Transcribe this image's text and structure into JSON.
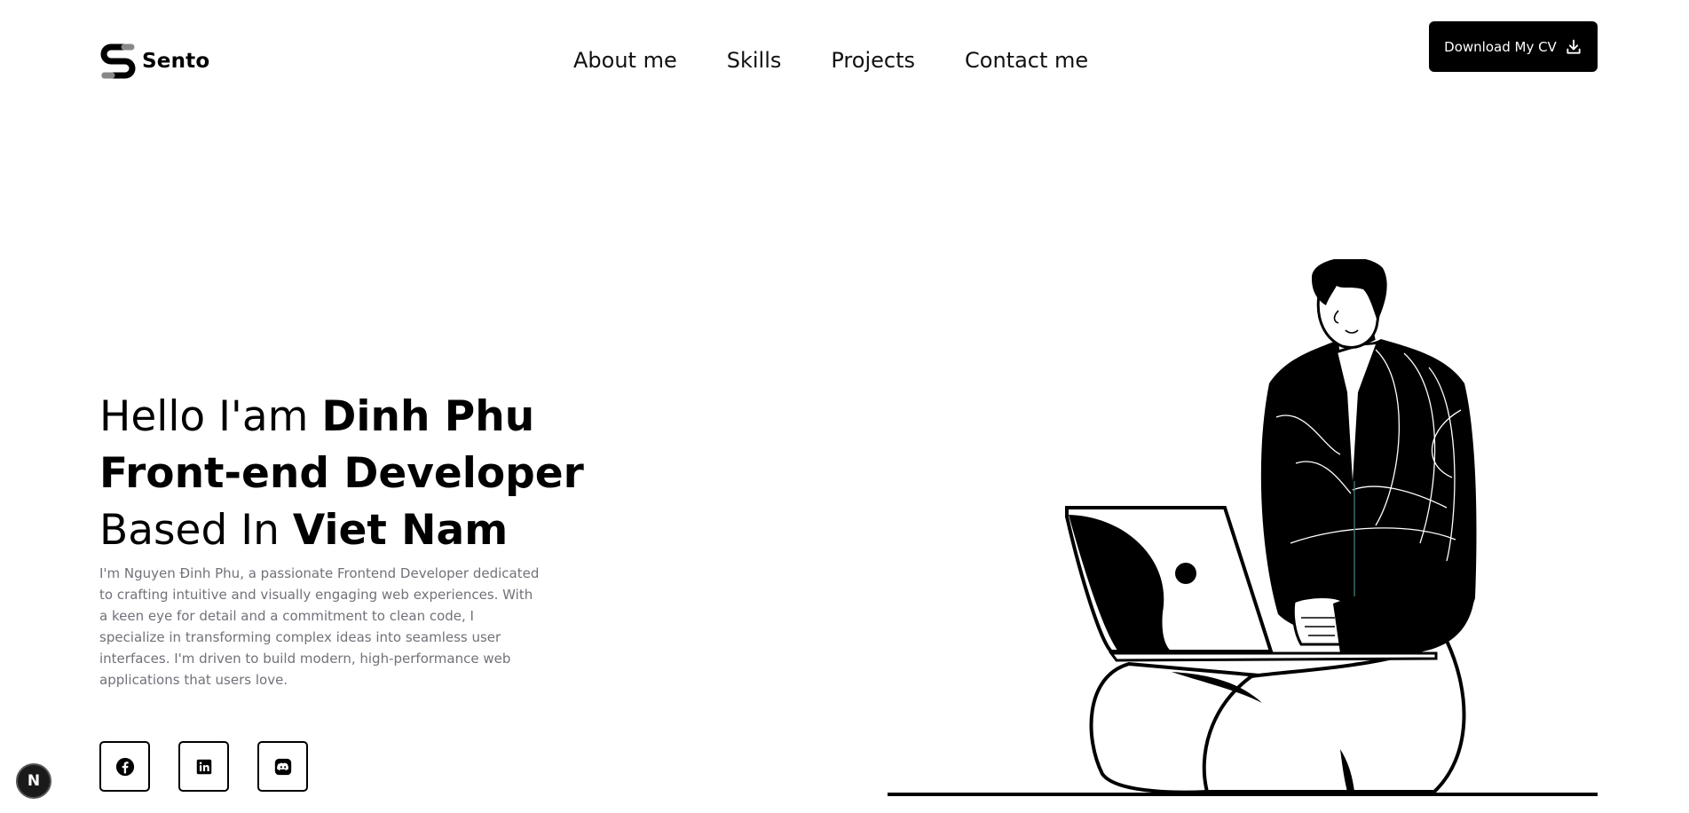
{
  "brand": {
    "name": "Sento",
    "icon": "sento-logo-icon"
  },
  "nav": {
    "items": [
      {
        "label": "About me"
      },
      {
        "label": "Skills"
      },
      {
        "label": "Projects"
      },
      {
        "label": "Contact me"
      }
    ]
  },
  "header": {
    "cv_button_label": "Download My CV",
    "cv_button_icon": "download-icon"
  },
  "hero": {
    "line1_light": "Hello I'am ",
    "line1_bold": "Dinh Phu",
    "line2_bold": "Front-end Developer",
    "line3_light": "Based In ",
    "line3_bold": "Viet Nam",
    "bio": "I'm Nguyen Đinh Phu, a passionate Frontend Developer dedicated to crafting intuitive and visually engaging web experiences. With a keen eye for detail and a commitment to clean code, I specialize in transforming complex ideas into seamless user interfaces. I'm driven to build modern, high-performance web applications that users love."
  },
  "socials": [
    {
      "icon": "facebook-icon"
    },
    {
      "icon": "linkedin-icon"
    },
    {
      "icon": "discord-icon"
    }
  ],
  "dev_badge": {
    "label": "N"
  },
  "colors": {
    "primary": "#000000",
    "background": "#ffffff",
    "muted_text": "#71717a"
  }
}
